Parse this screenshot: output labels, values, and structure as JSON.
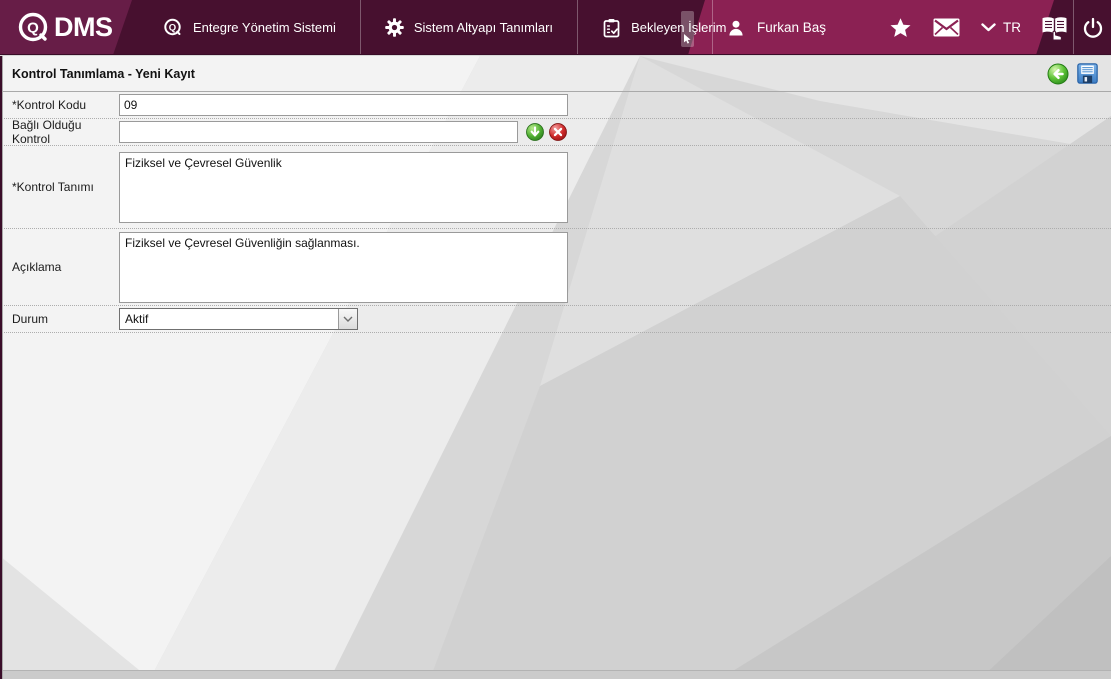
{
  "header": {
    "logo": {
      "q": "Q",
      "dms": "DMS"
    },
    "nav": [
      {
        "label": "Entegre Yönetim Sistemi",
        "icon": "qdms-ring-icon"
      },
      {
        "label": "Sistem Altyapı Tanımları",
        "icon": "gear-icon"
      },
      {
        "label": "Bekleyen İşlerim",
        "icon": "clipboard-check-icon"
      }
    ],
    "user_name": "Furkan Baş",
    "language": "TR",
    "icons": [
      "person-icon",
      "favorites-star-icon",
      "mail-icon",
      "chevron-down-icon",
      "user-manual-icon",
      "power-icon"
    ]
  },
  "page": {
    "title": "Kontrol Tanımlama - Yeni Kayıt"
  },
  "toolbar": {
    "icons": [
      "back-icon",
      "save-icon"
    ]
  },
  "form": {
    "kontrol_kodu": {
      "label": "*Kontrol Kodu",
      "value": "09"
    },
    "bagli_kontrol": {
      "label": "Bağlı Olduğu Kontrol",
      "value": "",
      "icons": [
        "pick-down-icon",
        "clear-icon"
      ]
    },
    "kontrol_tanimi": {
      "label": "*Kontrol Tanımı",
      "value": "Fiziksel ve Çevresel Güvenlik"
    },
    "aciklama": {
      "label": "Açıklama",
      "value": "Fiziksel ve Çevresel Güvenliğin sağlanması."
    },
    "durum": {
      "label": "Durum",
      "value": "Aktif"
    }
  },
  "colors": {
    "header_dark": "#47102f",
    "header_logo_section": "#671d47",
    "header_user_section": "#8b2153",
    "accent_green": "#3f9f2f",
    "accent_red": "#c11d1d",
    "save_blue": "#3b7cc4",
    "bg_gray": "#d7d7d7"
  }
}
